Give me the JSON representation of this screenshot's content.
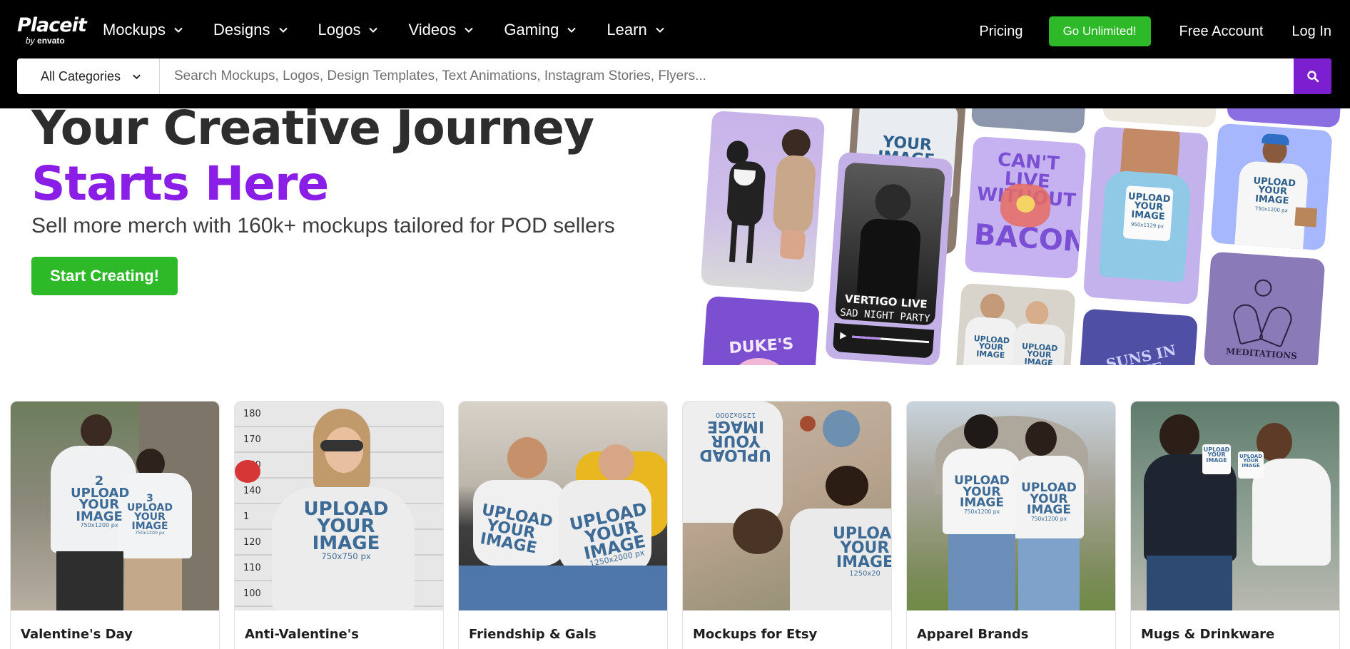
{
  "brand": {
    "name": "Placeit",
    "by": "by",
    "sub": "envato"
  },
  "nav": {
    "menu": [
      {
        "label": "Mockups"
      },
      {
        "label": "Designs"
      },
      {
        "label": "Logos"
      },
      {
        "label": "Videos"
      },
      {
        "label": "Gaming"
      },
      {
        "label": "Learn"
      }
    ],
    "pricing": "Pricing",
    "go_unlimited": "Go Unlimited!",
    "free_account": "Free Account",
    "login": "Log In"
  },
  "search": {
    "category": "All Categories",
    "placeholder": "Search Mockups, Logos, Design Templates, Text Animations, Instagram Stories, Flyers..."
  },
  "hero": {
    "title_line1": "Your Creative Journey",
    "title_line2": "Starts Here",
    "subtitle": "Sell more merch with 160k+ mockups tailored for POD sellers",
    "cta": "Start Creating!"
  },
  "collage": {
    "upload_text": [
      "UPLOAD",
      "YOUR",
      "IMAGE"
    ],
    "upload_dims": [
      "750x1200 px",
      "950x1129 px"
    ],
    "bacon": [
      "CAN'T LIVE",
      "WITHOUT",
      "BACON"
    ],
    "vertigo": [
      "VERTIGO LIVE",
      "SAD NIGHT PARTY"
    ],
    "dukes": "DUKE'S",
    "cosmos": "SUNS IN LIFE",
    "meditations": "MEDITATIONS"
  },
  "cards": [
    {
      "title": "Valentine's Day",
      "print_a": [
        "2",
        "UPLOAD",
        "YOUR",
        "IMAGE",
        "750x1200 px"
      ],
      "print_b": [
        "3",
        "UPLOAD",
        "YOUR",
        "IMAGE",
        "750x1200 px"
      ]
    },
    {
      "title": "Anti-Valentine's",
      "print_a": [
        "UPLOAD",
        "YOUR",
        "IMAGE",
        "750x750 px"
      ],
      "heights": [
        "180",
        "170",
        "160",
        "140",
        "1",
        "120",
        "110",
        "100"
      ]
    },
    {
      "title": "Friendship & Gals",
      "print_a": [
        "UPLOAD",
        "YOUR",
        "IMAGE"
      ],
      "print_b": [
        "UPLOAD",
        "YOUR",
        "IMAGE",
        "1250x2000 px"
      ]
    },
    {
      "title": "Mockups for Etsy",
      "print_a": [
        "UPLOAD",
        "YOUR",
        "IMAGE",
        "1250x2000"
      ],
      "print_b": [
        "UPLOAD",
        "YOUR",
        "IMAGE",
        "1250x20"
      ]
    },
    {
      "title": "Apparel Brands",
      "print_a": [
        "UPLOAD",
        "YOUR",
        "IMAGE",
        "750x1200 px"
      ],
      "print_b": [
        "UPLOAD",
        "YOUR",
        "IMAGE",
        "750x1200 px"
      ]
    },
    {
      "title": "Mugs & Drinkware",
      "print_a": [
        "UPLOAD",
        "YOUR",
        "IMAGE"
      ],
      "print_b": [
        "UPLOAD",
        "YOUR",
        "IMAGE"
      ]
    }
  ],
  "colors": {
    "brand_purple": "#8a1ee6",
    "search_purple": "#7b1fd0",
    "cta_green": "#2db928",
    "nav_bg": "#000000"
  },
  "icons": {
    "dropdown": "chevron-down-icon",
    "search": "search-icon",
    "play": "play-icon"
  }
}
